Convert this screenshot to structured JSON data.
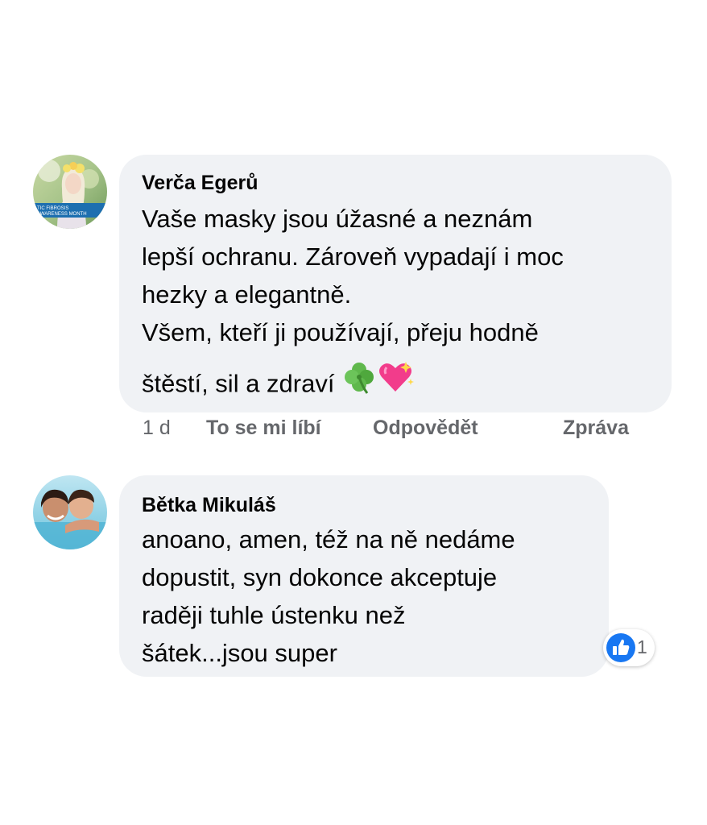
{
  "comments": [
    {
      "author": "Verča Egerů",
      "avatar_badge": "TIC FIBROSIS AWARENESS MONTH",
      "text_lines": [
        "Vaše masky jsou úžasné a neznám",
        "lepší ochranu. Zároveň vypadají i moc",
        "hezky a elegantně.",
        "Všem, kteří ji používají, přeju hodně",
        "štěstí, sil a zdraví"
      ],
      "emojis": [
        "four-leaf-clover",
        "sparkling-heart"
      ],
      "actions": {
        "time": "1 d",
        "like": "To se mi líbí",
        "reply": "Odpovědět",
        "message": "Zpráva"
      }
    },
    {
      "author": "Bětka Mikuláš",
      "text_lines": [
        "anoano, amen, též na ně nedáme",
        "dopustit, syn dokonce akceptuje",
        "raději tuhle ústenku než",
        "šátek...jsou super"
      ],
      "reaction": {
        "icon": "thumbs-up-icon",
        "color": "#1877f2",
        "count": "1"
      }
    }
  ],
  "colors": {
    "bubble": "#f0f2f5",
    "secondary_text": "#65676b",
    "primary_text": "#050505"
  }
}
